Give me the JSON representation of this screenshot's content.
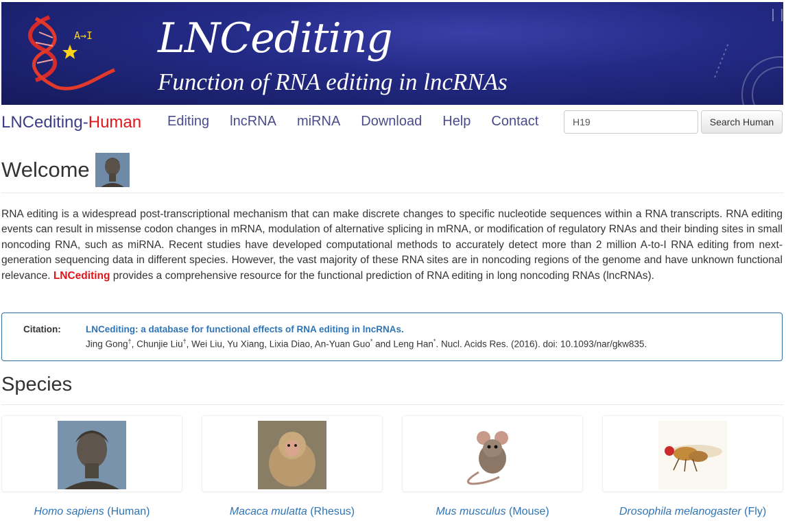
{
  "banner": {
    "title": "LNCediting",
    "subtitle": "Function of RNA editing in lncRNAs",
    "logo_text": "A→I"
  },
  "navbar": {
    "brand_main": "LNCediting-",
    "brand_highlight": "Human",
    "items": [
      "Editing",
      "lncRNA",
      "miRNA",
      "Download",
      "Help",
      "Contact"
    ],
    "search_value": "H19",
    "search_button": "Search Human"
  },
  "welcome": {
    "heading": "Welcome",
    "intro_before": "RNA editing is a widespread post-transcriptional mechanism that can make discrete changes to specific nucleotide sequences within a RNA transcripts. RNA editing events can result in missense codon changes in mRNA, modulation of alternative splicing in mRNA, or modification of regulatory RNAs and their binding sites in small noncoding RNA, such as miRNA. Recent studies have developed computational methods to accurately detect more than 2 million A-to-I RNA editing from next-generation sequencing data in different species. However, the vast majority of these RNA sites are in noncoding regions of the genome and have unknown functional relevance. ",
    "intro_highlight": "LNCediting",
    "intro_after": " provides a comprehensive resource for the functional prediction of RNA editing in long noncoding RNAs (lncRNAs)."
  },
  "citation": {
    "label": "Citation:",
    "title": "LNCediting: a database for functional effects of RNA editing in lncRNAs.",
    "authors_a": "Jing Gong",
    "sup_dagger": "†",
    "authors_b": ", Chunjie Liu",
    "authors_c": ", Wei Liu, Yu Xiang, Lixia Diao, An-Yuan Guo",
    "sup_star": "*",
    "authors_d": " and Leng Han",
    "authors_e": ". Nucl. Acids Res. (2016). doi: 10.1093/nar/gkw835."
  },
  "species": {
    "heading": "Species",
    "items": [
      {
        "latin": "Homo sapiens",
        "common": " (Human)",
        "icon": "human-statue-image"
      },
      {
        "latin": "Macaca mulatta",
        "common": " (Rhesus)",
        "icon": "rhesus-monkey-image"
      },
      {
        "latin": "Mus musculus",
        "common": " (Mouse)",
        "icon": "mouse-image"
      },
      {
        "latin": "Drosophila melanogaster",
        "common": " (Fly)",
        "icon": "fruit-fly-image"
      }
    ]
  },
  "colors": {
    "banner_bg": "#232a85",
    "brand_red": "#e0161b",
    "link_blue": "#2f74b5",
    "nav_purple": "#4b4b8e"
  }
}
